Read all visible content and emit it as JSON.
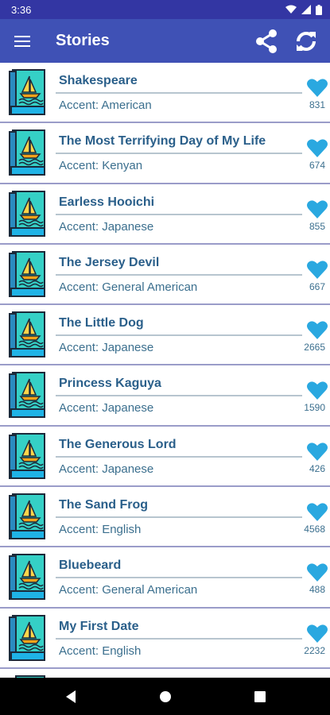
{
  "status_bar": {
    "time": "3:36"
  },
  "app_bar": {
    "title": "Stories"
  },
  "colors": {
    "primary": "#3f51b5",
    "status": "#3336a3",
    "title_text": "#2a5f8a",
    "heart": "#2aa8e0"
  },
  "stories": [
    {
      "title": "Shakespeare",
      "accent": "Accent: American",
      "likes": "831"
    },
    {
      "title": "The Most Terrifying Day of My Life",
      "accent": "Accent: Kenyan",
      "likes": "674"
    },
    {
      "title": "Earless Hooichi",
      "accent": "Accent: Japanese",
      "likes": "855"
    },
    {
      "title": "The Jersey Devil",
      "accent": "Accent: General American",
      "likes": "667"
    },
    {
      "title": "The Little Dog",
      "accent": "Accent: Japanese",
      "likes": "2665"
    },
    {
      "title": "Princess Kaguya",
      "accent": "Accent: Japanese",
      "likes": "1590"
    },
    {
      "title": "The Generous Lord",
      "accent": "Accent: Japanese",
      "likes": "426"
    },
    {
      "title": "The Sand Frog",
      "accent": "Accent: English",
      "likes": "4568"
    },
    {
      "title": "Bluebeard",
      "accent": "Accent: General American",
      "likes": "488"
    },
    {
      "title": "My First Date",
      "accent": "Accent: English",
      "likes": "2232"
    }
  ]
}
